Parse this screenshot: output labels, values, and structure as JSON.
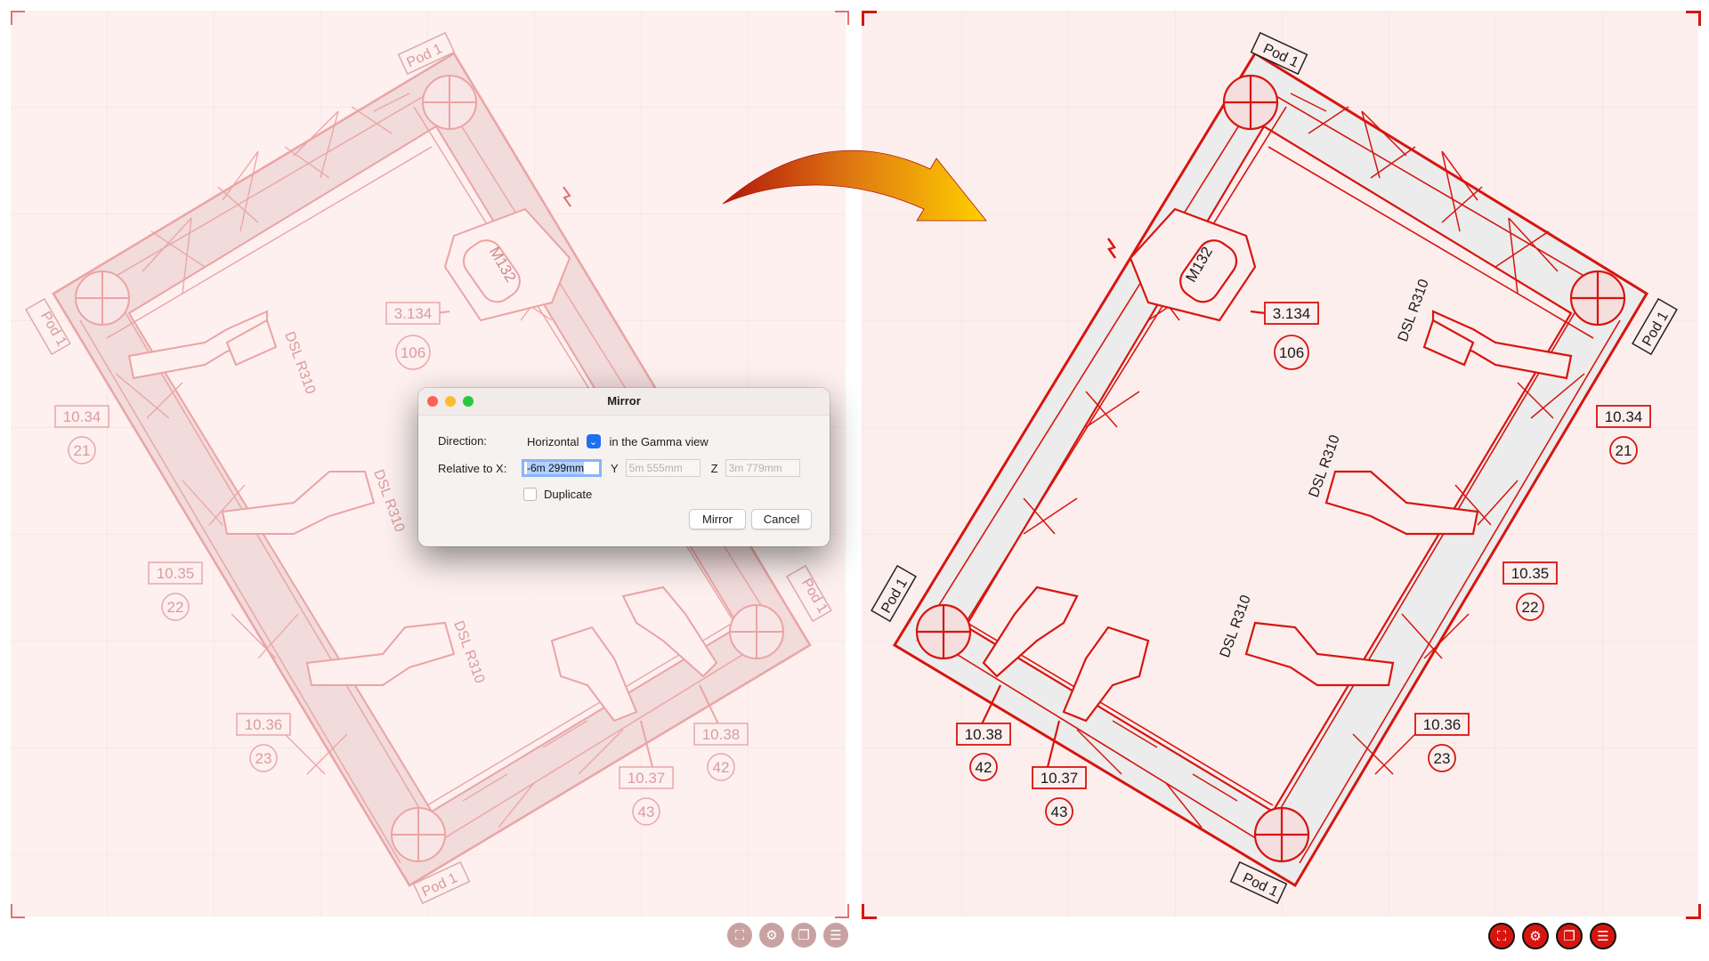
{
  "dialog": {
    "title": "Mirror",
    "direction_label": "Direction:",
    "direction_value": "Horizontal",
    "direction_suffix": "in the Gamma view",
    "relative_label": "Relative to X:",
    "x_value": "-6m 299mm",
    "y_label": "Y",
    "y_value": "5m 555mm",
    "z_label": "Z",
    "z_value": "3m 779mm",
    "duplicate_label": "Duplicate",
    "mirror_button": "Mirror",
    "cancel_button": "Cancel"
  },
  "left_plot": {
    "pods": [
      "Pod 1",
      "Pod 1",
      "Pod 1",
      "Pod 1"
    ],
    "fixture_m132": "M132",
    "dsl_labels": [
      "DSL R310",
      "DSL R310",
      "DSL R310"
    ],
    "positions": [
      "3.134",
      "10.34",
      "10.35",
      "10.36",
      "10.37",
      "10.38"
    ],
    "channels": [
      "106",
      "21",
      "22",
      "23",
      "43",
      "42"
    ]
  },
  "right_plot": {
    "pods": [
      "Pod 1",
      "Pod 1",
      "Pod 1",
      "Pod 1"
    ],
    "fixture_m132": "M132",
    "dsl_labels": [
      "DSL R310",
      "DSL R310",
      "DSL R310"
    ],
    "positions": [
      "3.134",
      "10.34",
      "10.35",
      "10.36",
      "10.37",
      "10.38"
    ],
    "channels": [
      "106",
      "21",
      "22",
      "23",
      "43",
      "42"
    ]
  },
  "toolbar_icons": [
    "fit-view-icon",
    "gear-icon",
    "layers-icon",
    "list-icon"
  ],
  "colors": {
    "accent_red": "#d7150f",
    "faded_red": "#e89a9a",
    "panel_bg": "#fdf0ef",
    "dialog_bg": "#f6f2f0",
    "select_blue": "#1f6ff2"
  }
}
